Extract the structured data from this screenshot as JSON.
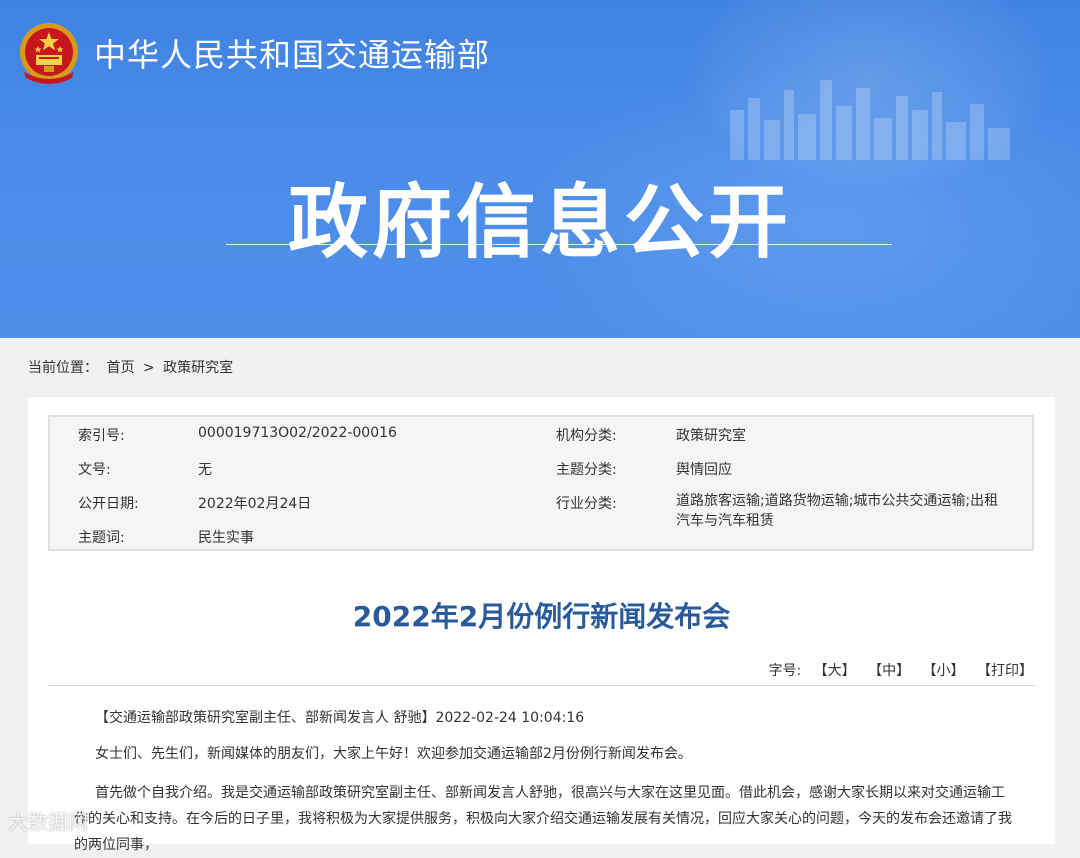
{
  "colors": {
    "banner": "#4a8ce8",
    "title_blue": "#2a5a9a",
    "background": "#f1f1f1"
  },
  "header": {
    "emblem_icon": "national-emblem-icon",
    "ministry_name": "中华人民共和国交通运输部",
    "section_title": "政府信息公开"
  },
  "breadcrumb": {
    "label": "当前位置：",
    "home": "首页",
    "separator": ">",
    "current": "政策研究室"
  },
  "meta": {
    "index_label": "索引号:",
    "index_value": "000019713O02/2022-00016",
    "org_label": "机构分类:",
    "org_value": "政策研究室",
    "doc_label": "文号:",
    "doc_value": "无",
    "topic_label": "主题分类:",
    "topic_value": "舆情回应",
    "date_label": "公开日期:",
    "date_value": "2022年02月24日",
    "industry_label": "行业分类:",
    "industry_value": "道路旅客运输;道路货物运输;城市公共交通运输;出租汽车与汽车租赁",
    "keyword_label": "主题词:",
    "keyword_value": "民生实事"
  },
  "article": {
    "title": "2022年2月份例行新闻发布会",
    "fontsize_label": "字号:",
    "opt_large": "【大】",
    "opt_medium": "【中】",
    "opt_small": "【小】",
    "opt_print": "【打印】",
    "p1": "【交通运输部政策研究室副主任、部新闻发言人 舒驰】2022-02-24 10:04:16",
    "p2": "女士们、先生们，新闻媒体的朋友们，大家上午好！欢迎参加交通运输部2月份例行新闻发布会。",
    "p3": "首先做个自我介绍。我是交通运输部政策研究室副主任、部新闻发言人舒驰，很高兴与大家在这里见面。借此机会，感谢大家长期以来对交通运输工作的关心和支持。在今后的日子里，我将积极为大家提供服务，积极向大家介绍交通运输发展有关情况，回应大家关心的问题，今天的发布会还邀请了我的两位同事，"
  },
  "watermark": "大数据网"
}
